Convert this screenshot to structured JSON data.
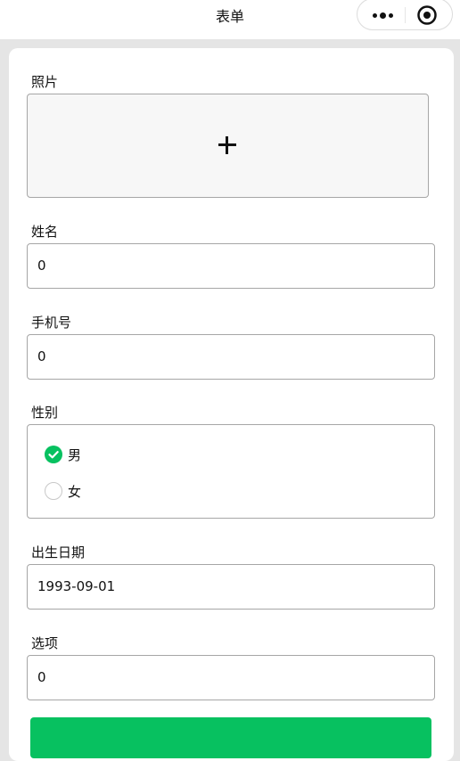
{
  "nav": {
    "title": "表单",
    "more_icon": "more-dots-icon",
    "home_icon": "target-icon"
  },
  "form": {
    "photo": {
      "label": "照片",
      "add_icon": "plus-icon"
    },
    "name": {
      "label": "姓名",
      "value": "0"
    },
    "phone": {
      "label": "手机号",
      "value": "0"
    },
    "gender": {
      "label": "性别",
      "options": [
        {
          "label": "男",
          "checked": true
        },
        {
          "label": "女",
          "checked": false
        }
      ]
    },
    "birthdate": {
      "label": "出生日期",
      "value": "1993-09-01"
    },
    "option": {
      "label": "选项",
      "value": "0"
    }
  },
  "colors": {
    "accent": "#07c160",
    "border": "#a6a6a6",
    "page_bg": "#e5e5e5"
  }
}
